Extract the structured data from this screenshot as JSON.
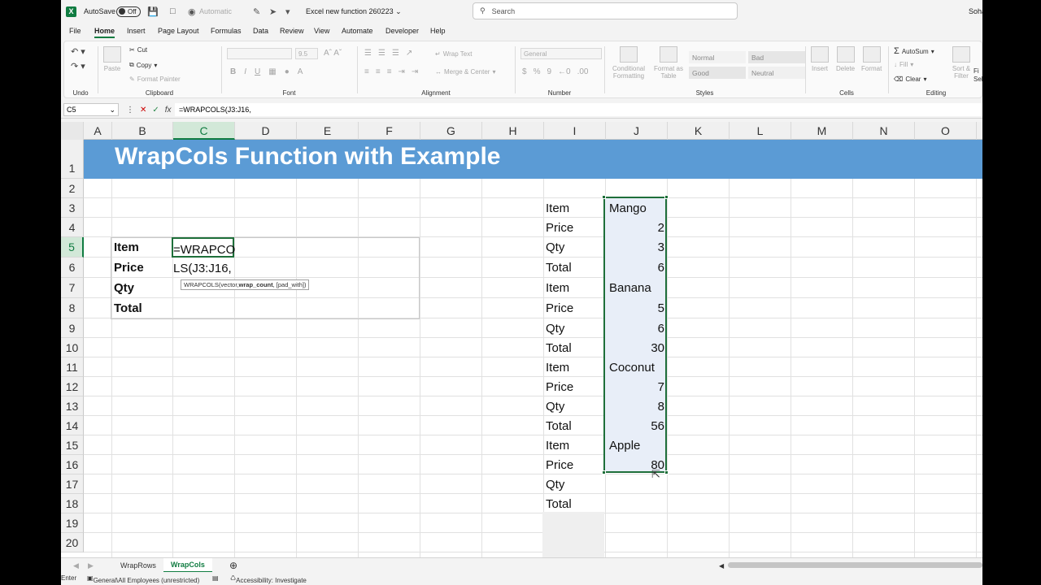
{
  "titlebar": {
    "autosave_label": "AutoSave",
    "autosave_state": "Off",
    "autocalc_label": "Automatic",
    "file_name": "Excel new function 260223",
    "search_placeholder": "Search",
    "user_partial": "Soha"
  },
  "tabs": [
    "File",
    "Home",
    "Insert",
    "Page Layout",
    "Formulas",
    "Data",
    "Review",
    "View",
    "Automate",
    "Developer",
    "Help"
  ],
  "active_tab": "Home",
  "ribbon": {
    "undo_group": "Undo",
    "clipboard": {
      "label": "Clipboard",
      "paste": "Paste",
      "cut": "Cut",
      "copy": "Copy",
      "format_painter": "Format Painter"
    },
    "font": {
      "label": "Font",
      "size": "9.5"
    },
    "alignment": {
      "label": "Alignment",
      "wrap_text": "Wrap Text",
      "merge_center": "Merge & Center"
    },
    "number": {
      "label": "Number",
      "format": "General"
    },
    "styles": {
      "label": "Styles",
      "conditional": "Conditional Formatting",
      "format_table": "Format as Table",
      "normal": "Normal",
      "bad": "Bad",
      "good": "Good",
      "neutral": "Neutral"
    },
    "cells": {
      "label": "Cells",
      "insert": "Insert",
      "delete": "Delete",
      "format": "Format"
    },
    "editing": {
      "label": "Editing",
      "autosum": "AutoSum",
      "fill": "Fill",
      "clear": "Clear",
      "sort_filter": "Sort & Filter",
      "find_partial": "Fi",
      "select_partial": "Sel"
    }
  },
  "formula_bar": {
    "name_box": "C5",
    "formula": "=WRAPCOLS(J3:J16,"
  },
  "columns": [
    "A",
    "B",
    "C",
    "D",
    "E",
    "F",
    "G",
    "H",
    "I",
    "J",
    "K",
    "L",
    "M",
    "N",
    "O"
  ],
  "rows": [
    "1",
    "2",
    "3",
    "4",
    "5",
    "6",
    "7",
    "8",
    "9",
    "10",
    "11",
    "12",
    "13",
    "14",
    "15",
    "16",
    "17",
    "18",
    "19",
    "20"
  ],
  "sheet_title": "WrapCols Function with Example",
  "left_table": {
    "labels": [
      "Item",
      "Price",
      "Qty",
      "Total"
    ],
    "edit_line1": "=WRAPCO",
    "edit_line2": "LS(J3:J16,"
  },
  "tooltip": {
    "fn": "WRAPCOLS(",
    "arg1": "vector, ",
    "arg2": "wrap_count",
    "arg3": ", [pad_with])"
  },
  "right_data": [
    {
      "label": "Item",
      "value": "Mango"
    },
    {
      "label": "Price",
      "value": "2"
    },
    {
      "label": "Qty",
      "value": "3"
    },
    {
      "label": "Total",
      "value": "6"
    },
    {
      "label": "Item",
      "value": "Banana"
    },
    {
      "label": "Price",
      "value": "5"
    },
    {
      "label": "Qty",
      "value": "6"
    },
    {
      "label": "Total",
      "value": "30"
    },
    {
      "label": "Item",
      "value": "Coconut"
    },
    {
      "label": "Price",
      "value": "7"
    },
    {
      "label": "Qty",
      "value": "8"
    },
    {
      "label": "Total",
      "value": "56"
    },
    {
      "label": "Item",
      "value": "Apple"
    },
    {
      "label": "Price",
      "value": "80"
    },
    {
      "label": "Qty",
      "value": ""
    },
    {
      "label": "Total",
      "value": ""
    }
  ],
  "sheet_tabs": [
    "WrapRows",
    "WrapCols"
  ],
  "active_sheet": "WrapCols",
  "status": {
    "mode": "Enter",
    "sensitivity": "General\\All Employees (unrestricted)",
    "accessibility": "Accessibility: Investigate"
  },
  "colors": {
    "excel_green": "#107c41",
    "title_band": "#5b9bd5",
    "selection_fill": "#e8eef8"
  }
}
